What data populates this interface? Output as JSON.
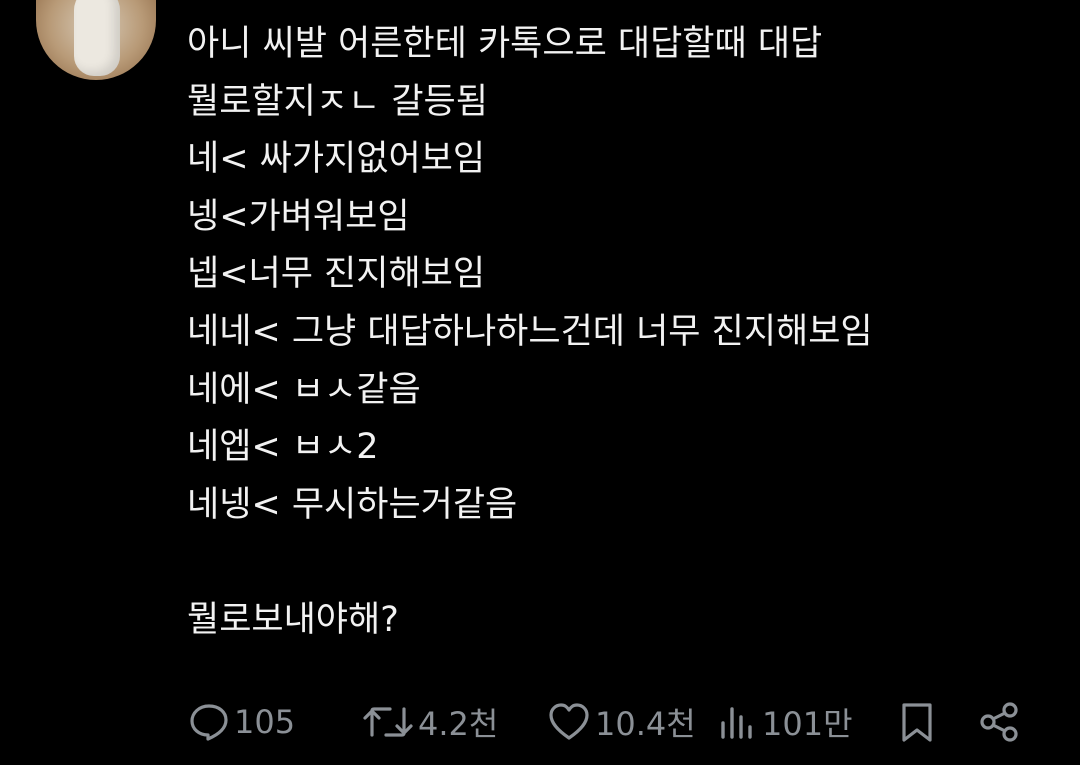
{
  "post": {
    "lines": [
      "아니 씨발 어른한테 카톡으로 대답할때 대답",
      "뭘로할지ㅈㄴ 갈등됨",
      "네< 싸가지없어보임",
      "넹<가벼워보임",
      "넵<너무 진지해보임",
      "네네< 그냥 대답하나하느건데 너무 진지해보임",
      "네에< ㅂㅅ같음",
      "네엡< ㅂㅅ2",
      "네넹< 무시하는거같음",
      "뭘로보내야해?"
    ]
  },
  "actions": {
    "reply_count": "105",
    "repost_count": "4.2천",
    "like_count": "10.4천",
    "views_count": "101만"
  },
  "icons": {
    "reply": "speech-bubble-icon",
    "repost": "repost-arrows-icon",
    "like": "heart-icon",
    "views": "bar-chart-icon",
    "bookmark": "bookmark-icon",
    "share": "share-icon"
  },
  "colors": {
    "background": "#000000",
    "text": "#f2f2f2",
    "icon": "#8b9096"
  }
}
